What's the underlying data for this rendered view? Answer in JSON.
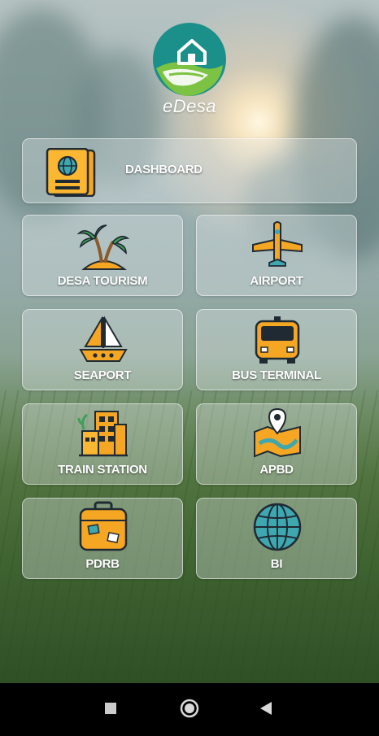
{
  "app": {
    "name": "eDesa"
  },
  "menu": {
    "dashboard": {
      "label": "DASHBOARD",
      "icon": "passport-icon"
    },
    "items": [
      {
        "label": "DESA TOURISM",
        "icon": "palm-island-icon"
      },
      {
        "label": "AIRPORT",
        "icon": "airplane-icon"
      },
      {
        "label": "SEAPORT",
        "icon": "sailboat-icon"
      },
      {
        "label": "BUS TERMINAL",
        "icon": "bus-icon"
      },
      {
        "label": "TRAIN STATION",
        "icon": "city-buildings-icon"
      },
      {
        "label": "APBD",
        "icon": "map-pin-icon"
      },
      {
        "label": "PDRB",
        "icon": "suitcase-icon"
      },
      {
        "label": "BI",
        "icon": "globe-icon"
      }
    ]
  },
  "navigation_bar": {
    "recent": "square-icon",
    "home": "circle-icon",
    "back": "triangle-back-icon"
  },
  "colors": {
    "accent_orange": "#f5a623",
    "icon_outline": "#1f2a33",
    "logo_teal": "#1b8f8a",
    "logo_green": "#7cc243"
  }
}
